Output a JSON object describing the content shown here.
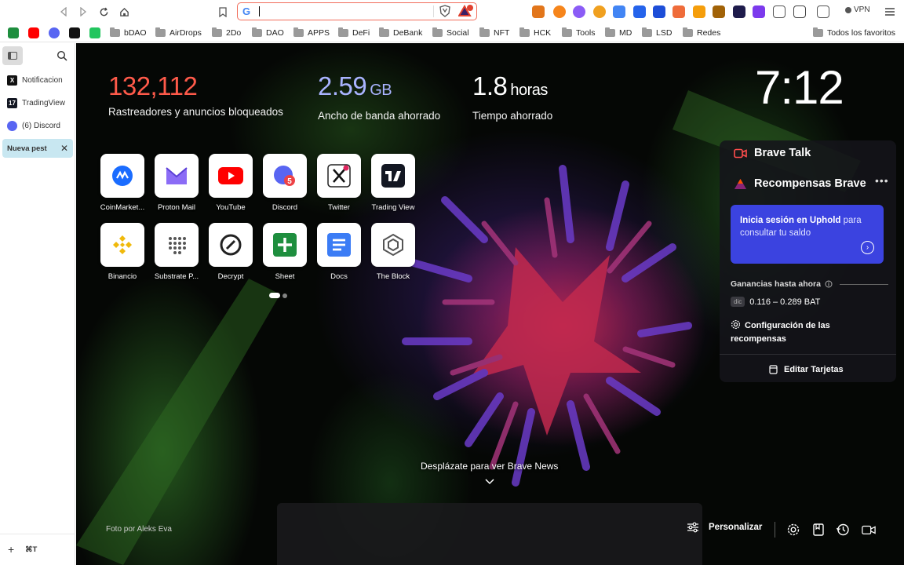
{
  "browser": {
    "url_value": "",
    "vpn_label": "VPN",
    "bookmarks": {
      "folders": [
        "bDAO",
        "AirDrops",
        "2Do",
        "DAO",
        "APPS",
        "DeFi",
        "DeBank",
        "Social",
        "NFT",
        "HCK",
        "Tools",
        "MD",
        "LSD",
        "Redes"
      ],
      "all_favorites": "Todos los favoritos"
    }
  },
  "sidebar": {
    "tabs": [
      {
        "label": "Notificacion",
        "icon": "x-icon"
      },
      {
        "label": "TradingView",
        "icon": "tradingview-icon"
      },
      {
        "label": "(6) Discord",
        "icon": "discord-icon"
      },
      {
        "label": "Nueva pest",
        "icon": "none",
        "active": true
      }
    ],
    "new_tab_shortcut": "⌘T"
  },
  "stats": {
    "trackers_value": "132,112",
    "trackers_label": "Rastreadores y anuncios bloqueados",
    "bandwidth_value": "2.59",
    "bandwidth_unit": "GB",
    "bandwidth_label": "Ancho de banda ahorrado",
    "time_value": "1.8",
    "time_unit": "horas",
    "time_label": "Tiempo ahorrado"
  },
  "clock": "7:12",
  "top_sites": [
    {
      "name": "CoinMarket...",
      "icon": "coinmarketcap-icon"
    },
    {
      "name": "Proton Mail",
      "icon": "protonmail-icon"
    },
    {
      "name": "YouTube",
      "icon": "youtube-icon"
    },
    {
      "name": "Discord",
      "icon": "discord-icon"
    },
    {
      "name": "Twitter",
      "icon": "x-icon"
    },
    {
      "name": "Trading View",
      "icon": "tradingview-icon"
    },
    {
      "name": "Binancio",
      "icon": "binance-icon"
    },
    {
      "name": "Substrate P...",
      "icon": "substrate-icon"
    },
    {
      "name": "Decrypt",
      "icon": "decrypt-icon"
    },
    {
      "name": "Sheet",
      "icon": "sheets-icon"
    },
    {
      "name": "Docs",
      "icon": "docs-icon"
    },
    {
      "name": "The Block",
      "icon": "theblock-icon"
    }
  ],
  "widget": {
    "talk_title": "Brave Talk",
    "rewards_title": "Recompensas Brave",
    "more": "•••",
    "uphold_bold": "Inicia sesión en Uphold",
    "uphold_rest": " para consultar tu saldo",
    "earnings_label": "Ganancias hasta ahora",
    "earnings_month": "dic",
    "earnings_value": "0.116 – 0.289 BAT",
    "config_label": "Configuración de las recompensas",
    "edit_cards": "Editar Tarjetas"
  },
  "news_hint": "Desplázate para ver Brave News",
  "photo_credit": "Foto por Aleks Eva",
  "personalize_label": "Personalizar",
  "colors": {
    "accent_orange": "#f26d5b",
    "stat_trackers": "#ff5a4a",
    "stat_bandwidth": "#a9b3ff",
    "uphold": "#3b43e0"
  }
}
